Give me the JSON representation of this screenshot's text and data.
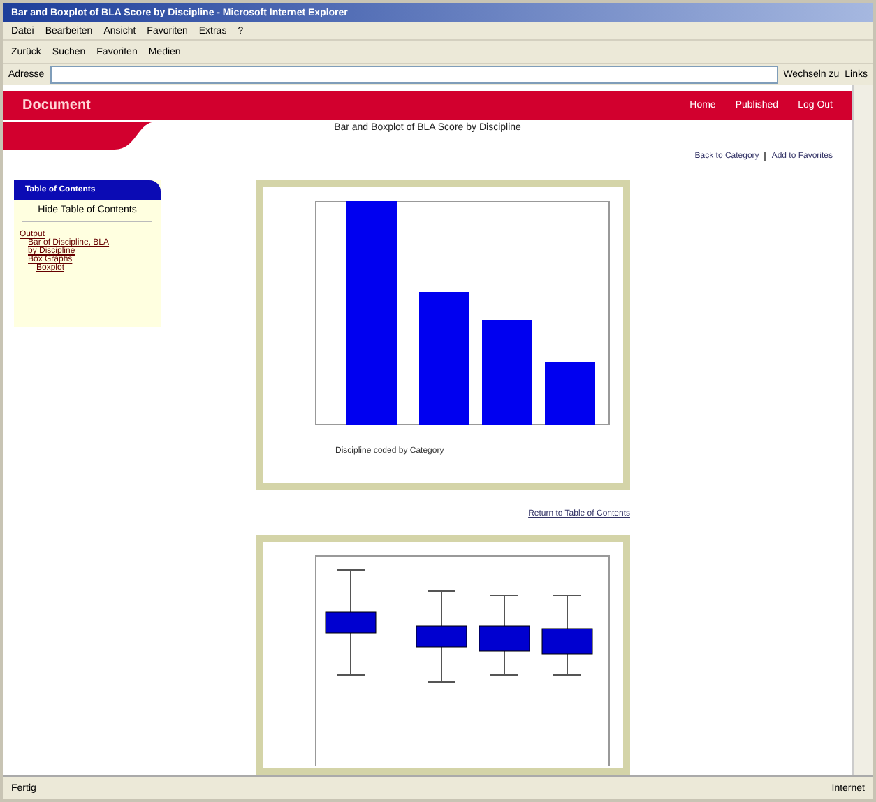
{
  "window": {
    "title": "Bar and Boxplot of BLA Score by Discipline - Microsoft Internet Explorer"
  },
  "menu": [
    "Datei",
    "Bearbeiten",
    "Ansicht",
    "Favoriten",
    "Extras",
    "?"
  ],
  "toolbar": [
    "Zurück",
    "Suchen",
    "Favoriten",
    "Medien"
  ],
  "address": {
    "label": "Adresse",
    "go": "Wechseln zu",
    "links": "Links"
  },
  "header": {
    "brand": "Document",
    "nav": [
      "Home",
      "Published",
      "Log Out"
    ]
  },
  "page_title": "Bar and Boxplot of BLA Score by Discipline",
  "top_links": [
    "Back to Category",
    "Add to Favorites"
  ],
  "toc": {
    "title": "Table of Contents",
    "hide": "Hide Table of Contents",
    "items": [
      {
        "label": "Output",
        "children": [
          {
            "label": "Bar of Discipline, BLA"
          },
          {
            "label": "by Discipline"
          },
          {
            "label": "Box Graphs",
            "children": [
              {
                "label": "Boxplot"
              }
            ]
          }
        ]
      }
    ]
  },
  "bar_chart": {
    "xlabel": "Discipline coded by Category"
  },
  "return_link": "Return to Table of Contents",
  "status_bar": {
    "text": "Fertig",
    "zone": "Internet"
  }
}
